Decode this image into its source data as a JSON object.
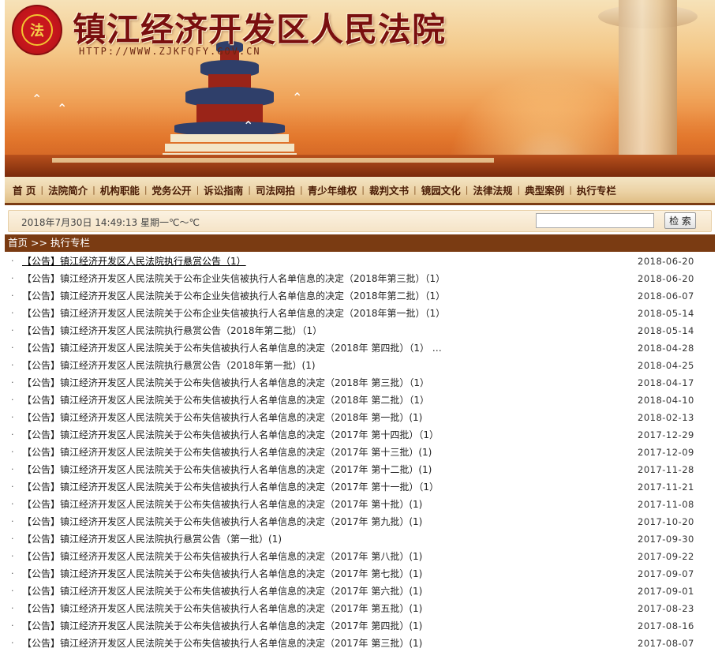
{
  "header": {
    "site_title": "镇江经济开发区人民法院",
    "site_url": "HTTP://WWW.ZJKFQFY.GOV.CN",
    "emblem_text": "法"
  },
  "nav": {
    "items": [
      "首 页",
      "法院简介",
      "机构职能",
      "党务公开",
      "诉讼指南",
      "司法网拍",
      "青少年维权",
      "裁判文书",
      "镜园文化",
      "法律法规",
      "典型案例",
      "执行专栏"
    ]
  },
  "infobar": {
    "datetime": "2018年7月30日 14:49:13 星期一℃～℃",
    "search_value": "",
    "search_button": "检 索"
  },
  "breadcrumb": {
    "home": "首页",
    "separator": ">>",
    "current": "执行专栏"
  },
  "list": {
    "bullet": "·",
    "items": [
      {
        "title": "【公告】镇江经济开发区人民法院执行悬赏公告（1）",
        "date": "2018-06-20"
      },
      {
        "title": "【公告】镇江经济开发区人民法院关于公布企业失信被执行人名单信息的决定（2018年第三批）（1）",
        "date": "2018-06-20"
      },
      {
        "title": "【公告】镇江经济开发区人民法院关于公布企业失信被执行人名单信息的决定（2018年第二批）（1）",
        "date": "2018-06-07"
      },
      {
        "title": "【公告】镇江经济开发区人民法院关于公布企业失信被执行人名单信息的决定（2018年第一批）（1）",
        "date": "2018-05-14"
      },
      {
        "title": "【公告】镇江经济开发区人民法院执行悬赏公告（2018年第二批）（1）",
        "date": "2018-05-14"
      },
      {
        "title": "【公告】镇江经济开发区人民法院关于公布失信被执行人名单信息的决定（2018年 第四批）（1） …",
        "date": "2018-04-28"
      },
      {
        "title": "【公告】镇江经济开发区人民法院执行悬赏公告（2018年第一批）(1)",
        "date": "2018-04-25"
      },
      {
        "title": "【公告】镇江经济开发区人民法院关于公布失信被执行人名单信息的决定（2018年 第三批）（1）",
        "date": "2018-04-17"
      },
      {
        "title": "【公告】镇江经济开发区人民法院关于公布失信被执行人名单信息的决定（2018年 第二批）（1）",
        "date": "2018-04-10"
      },
      {
        "title": "【公告】镇江经济开发区人民法院关于公布失信被执行人名单信息的决定（2018年 第一批）(1)",
        "date": "2018-02-13"
      },
      {
        "title": "【公告】镇江经济开发区人民法院关于公布失信被执行人名单信息的决定（2017年 第十四批）（1）",
        "date": "2017-12-29"
      },
      {
        "title": "【公告】镇江经济开发区人民法院关于公布失信被执行人名单信息的决定（2017年 第十三批）(1)",
        "date": "2017-12-09"
      },
      {
        "title": "【公告】镇江经济开发区人民法院关于公布失信被执行人名单信息的决定（2017年 第十二批）(1)",
        "date": "2017-11-28"
      },
      {
        "title": "【公告】镇江经济开发区人民法院关于公布失信被执行人名单信息的决定（2017年 第十一批）（1）",
        "date": "2017-11-21"
      },
      {
        "title": "【公告】镇江经济开发区人民法院关于公布失信被执行人名单信息的决定（2017年 第十批）(1)",
        "date": "2017-11-08"
      },
      {
        "title": "【公告】镇江经济开发区人民法院关于公布失信被执行人名单信息的决定（2017年 第九批）(1)",
        "date": "2017-10-20"
      },
      {
        "title": "【公告】镇江经济开发区人民法院执行悬赏公告（第一批）(1)",
        "date": "2017-09-30"
      },
      {
        "title": "【公告】镇江经济开发区人民法院关于公布失信被执行人名单信息的决定（2017年 第八批）(1)",
        "date": "2017-09-22"
      },
      {
        "title": "【公告】镇江经济开发区人民法院关于公布失信被执行人名单信息的决定（2017年 第七批）(1)",
        "date": "2017-09-07"
      },
      {
        "title": "【公告】镇江经济开发区人民法院关于公布失信被执行人名单信息的决定（2017年 第六批）(1)",
        "date": "2017-09-01"
      },
      {
        "title": "【公告】镇江经济开发区人民法院关于公布失信被执行人名单信息的决定（2017年 第五批）(1)",
        "date": "2017-08-23"
      },
      {
        "title": "【公告】镇江经济开发区人民法院关于公布失信被执行人名单信息的决定（2017年 第四批）(1)",
        "date": "2017-08-16"
      },
      {
        "title": "【公告】镇江经济开发区人民法院关于公布失信被执行人名单信息的决定（2017年 第三批）(1)",
        "date": "2017-08-07"
      }
    ]
  }
}
